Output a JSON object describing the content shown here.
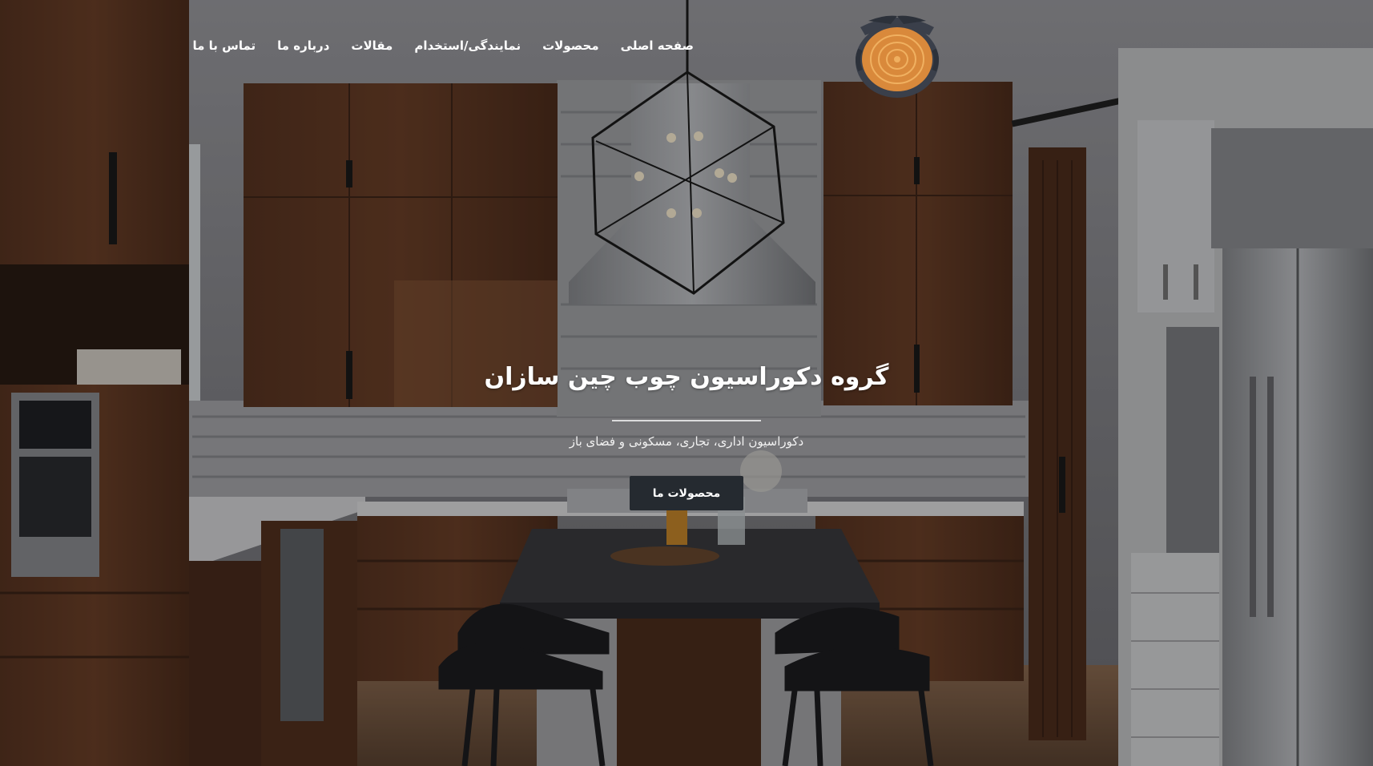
{
  "nav": {
    "items": [
      {
        "label": "صفحه اصلی"
      },
      {
        "label": "محصولات"
      },
      {
        "label": "نمایندگی/استخدام"
      },
      {
        "label": "مقالات"
      },
      {
        "label": "درباره ما"
      },
      {
        "label": "تماس با ما"
      }
    ]
  },
  "logo": {
    "icon": "wood-slice-logo"
  },
  "hero": {
    "title": "گروه دکوراسیون چوب چین سازان",
    "subtitle": "دکوراسیون اداری، تجاری، مسکونی و فضای باز",
    "cta_label": "محصولات ما",
    "background": "kitchen-interior-photo"
  },
  "colors": {
    "overlay": "#000000",
    "cta_background": "#252a30",
    "logo_wood": "#d9893b",
    "logo_bark": "#3a3f4a",
    "text": "#ffffff"
  }
}
